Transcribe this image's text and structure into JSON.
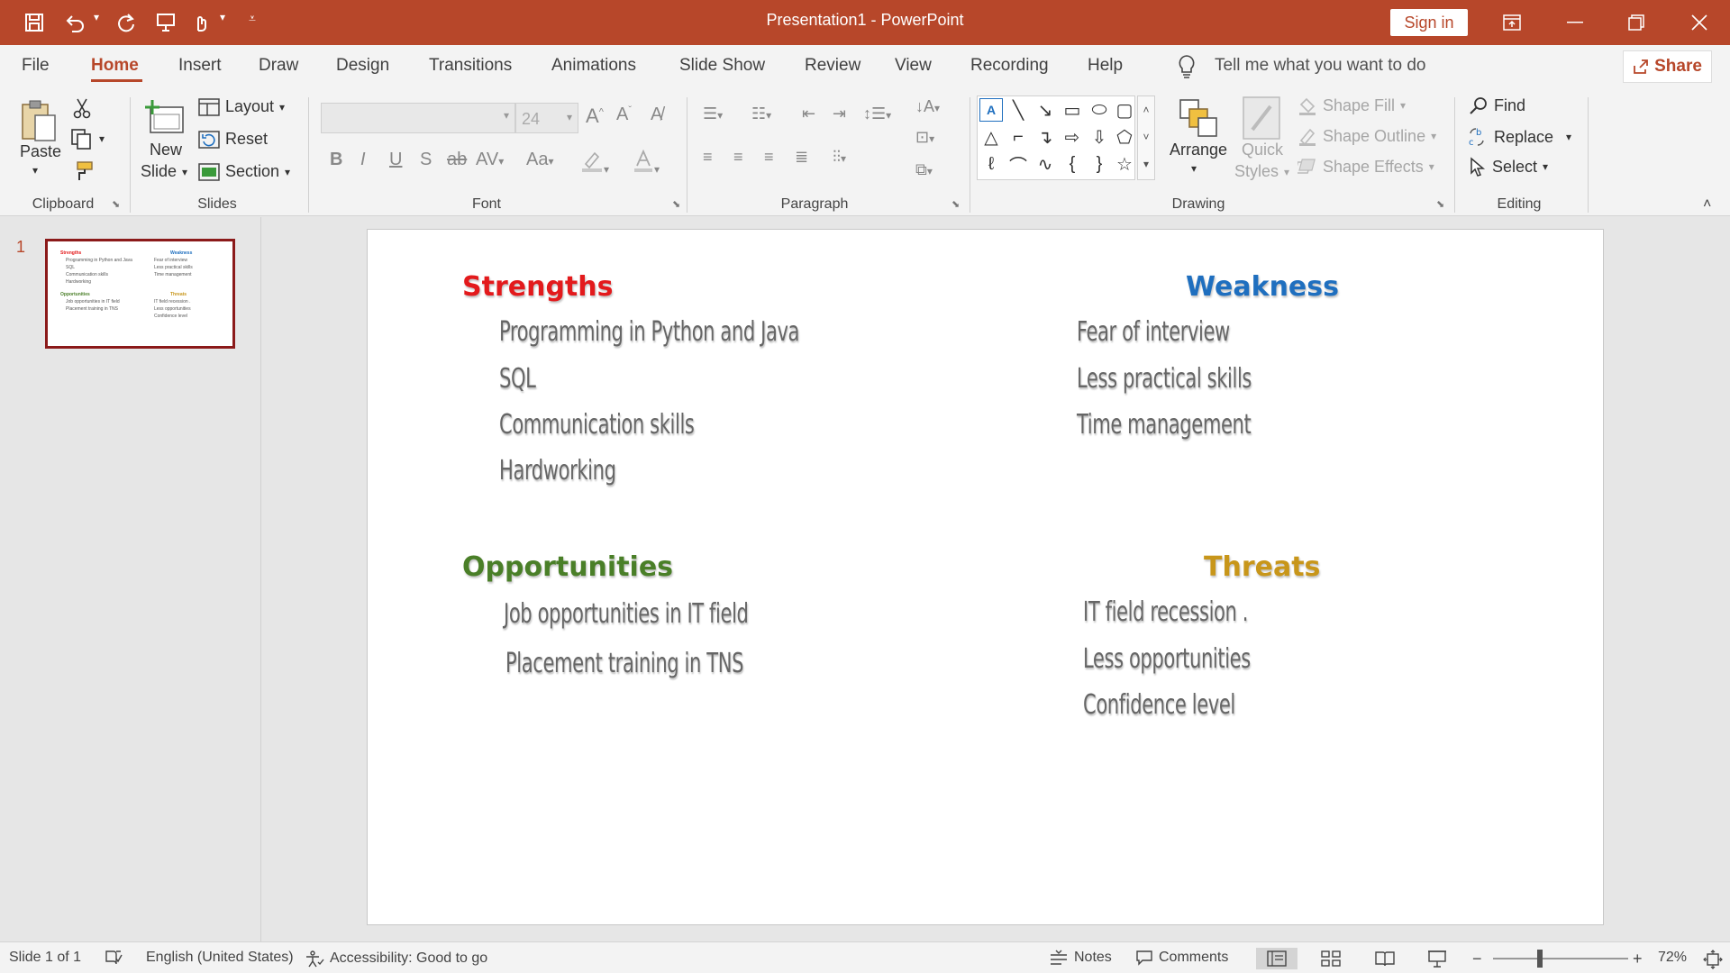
{
  "titlebar": {
    "title": "Presentation1  -  PowerPoint",
    "sign_in": "Sign in"
  },
  "tabs": [
    "File",
    "Home",
    "Insert",
    "Draw",
    "Design",
    "Transitions",
    "Animations",
    "Slide Show",
    "Review",
    "View",
    "Recording",
    "Help"
  ],
  "active_tab": "Home",
  "tell_me": "Tell me what you want to do",
  "share": "Share",
  "ribbon": {
    "clipboard": {
      "label": "Clipboard",
      "paste": "Paste"
    },
    "slides": {
      "label": "Slides",
      "new_slide_1": "New",
      "new_slide_2": "Slide",
      "layout": "Layout",
      "reset": "Reset",
      "section": "Section"
    },
    "font": {
      "label": "Font",
      "size": "24"
    },
    "paragraph": {
      "label": "Paragraph"
    },
    "drawing": {
      "label": "Drawing",
      "arrange": "Arrange",
      "quick_styles_1": "Quick",
      "quick_styles_2": "Styles",
      "shape_fill": "Shape Fill",
      "shape_outline": "Shape Outline",
      "shape_effects": "Shape Effects"
    },
    "editing": {
      "label": "Editing",
      "find": "Find",
      "replace": "Replace",
      "select": "Select"
    }
  },
  "thumbnail": {
    "number": "1"
  },
  "slide": {
    "strengths": {
      "title": "Strengths",
      "color": "#e31a1c",
      "items": [
        "Programming in Python and Java",
        "SQL",
        "Communication skills",
        "Hardworking"
      ]
    },
    "weakness": {
      "title": "Weakness",
      "color": "#1f6fbf",
      "items": [
        "Fear of interview",
        "Less practical  skills",
        "Time management"
      ]
    },
    "opportunities": {
      "title": "Opportunities",
      "color": "#4a7f28",
      "items": [
        "Job opportunities in IT  field",
        "Placement training in TNS"
      ]
    },
    "threats": {
      "title": "Threats",
      "color": "#c8961a",
      "items": [
        "IT field recession .",
        "Less opportunities",
        "Confidence level"
      ]
    }
  },
  "statusbar": {
    "slide_info": "Slide 1 of 1",
    "language": "English (United States)",
    "accessibility": "Accessibility: Good to go",
    "notes": "Notes",
    "comments": "Comments",
    "zoom": "72%",
    "zoom_level": 0.72
  }
}
